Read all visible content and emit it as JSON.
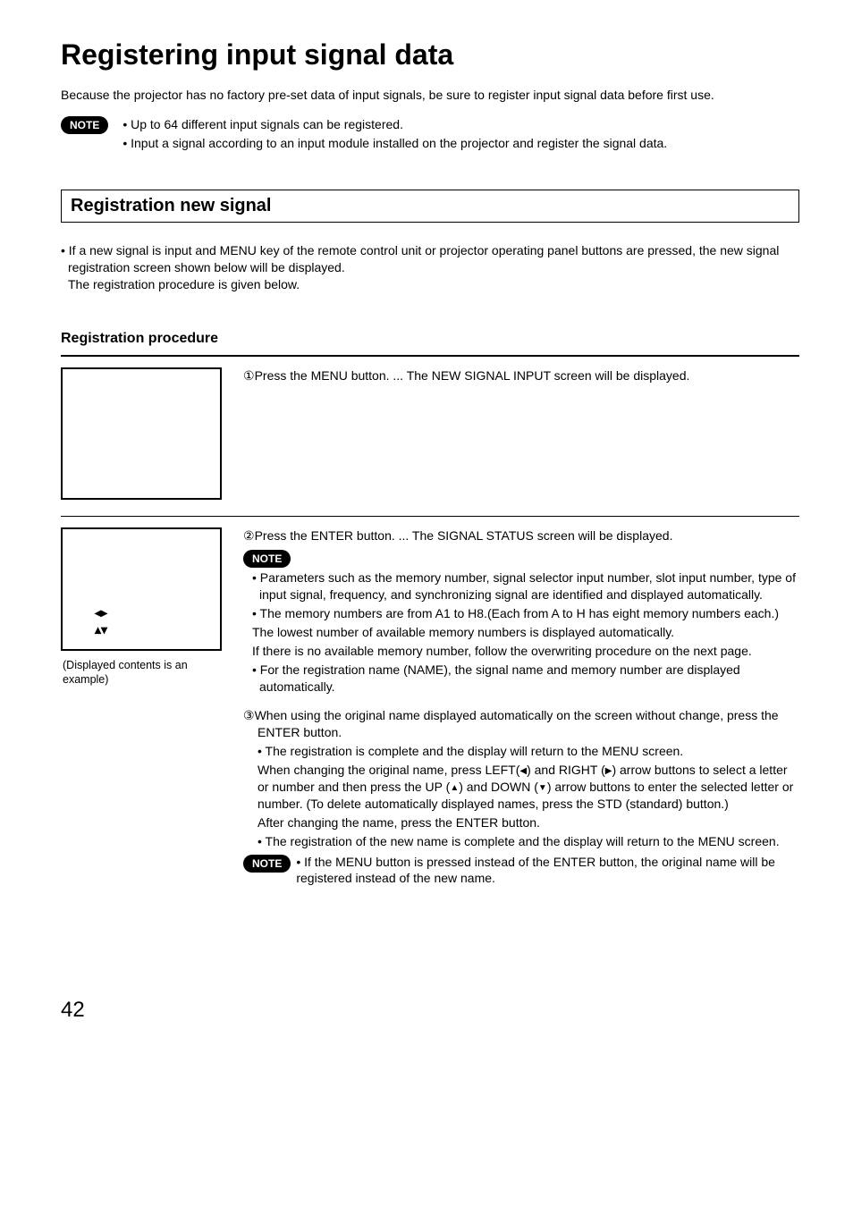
{
  "title": "Registering input signal data",
  "intro": "Because the projector has no factory pre-set data of input signals, be sure to register input signal data before first use.",
  "noteLabel": "NOTE",
  "topNotes": [
    "• Up to 64 different input signals can be registered.",
    "• Input a signal according to an input module installed on the projector and register the signal data."
  ],
  "section1": {
    "heading": "Registration new signal",
    "intro1": "• If a new signal is input and MENU key of the remote control unit or projector operating panel buttons are pressed, the new signal registration screen shown below will be displayed.",
    "intro2": "The registration procedure is given below."
  },
  "procHeading": "Registration procedure",
  "step1": "Press the MENU button. ... The NEW SIGNAL INPUT screen will be displayed.",
  "step2": {
    "lead": "Press the ENTER button. ... The SIGNAL STATUS screen will be displayed.",
    "note1": "• Parameters such as the memory number, signal selector input number, slot input number, type of input signal, frequency, and synchronizing signal are identified and displayed automatically.",
    "note2a": "• The memory numbers are from A1 to H8.(Each from A to H has eight memory numbers each.)",
    "note2b": "The lowest number of available memory numbers is displayed automatically.",
    "note2c": "If there is no available memory number, follow the overwriting procedure on the next page.",
    "note3": "• For the registration name (NAME), the signal name and memory number are displayed automatically."
  },
  "figureCaption": "(Displayed contents is an example)",
  "step3": {
    "lead1": "When using the original name displayed automatically on the screen without change, press the ENTER button.",
    "sub1": "• The registration is complete and the display will return to the MENU screen.",
    "sub2a": "When changing the original name, press LEFT(",
    "sub2b": ") and RIGHT (",
    "sub2c": ") arrow buttons to select a letter or number and then press the UP (",
    "sub2d": ") and DOWN (",
    "sub2e": ") arrow buttons to enter the selected letter or number. (To delete automatically displayed names, press the STD (standard) button.)",
    "sub3": "After changing the name, press the ENTER button.",
    "sub4": "• The registration of the new name is complete and the display will return to the MENU screen.",
    "finalNote": "• If the MENU button is pressed instead of the ENTER button, the original name will be registered instead of the new name."
  },
  "pageNumber": "42"
}
